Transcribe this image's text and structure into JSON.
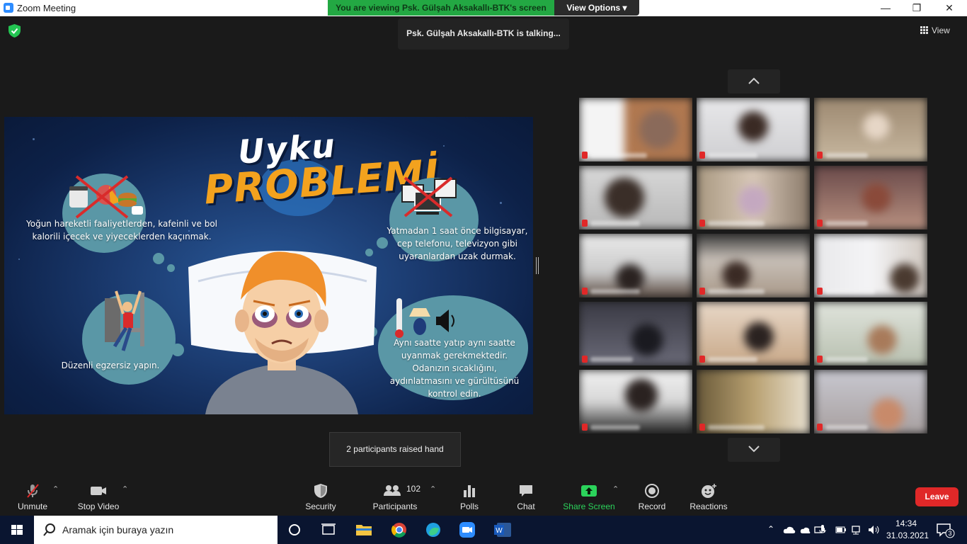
{
  "window": {
    "title": "Zoom Meeting",
    "minimize": "—",
    "maximize": "❐",
    "close": "✕"
  },
  "share_banner": {
    "viewing": "You are viewing Psk. Gülşah Aksakallı-BTK's screen",
    "view_options": "View Options ▾"
  },
  "talking": "Psk. Gülşah Aksakallı-BTK is talking...",
  "view_button": "View",
  "slide": {
    "title_line1": "Uyku",
    "title_line2": "PROBLEMİ",
    "tip1": "Yoğun hareketli faaliyetlerden, kafeinli ve bol kalorili içecek ve yiyeceklerden kaçınmak.",
    "tip2": "Yatmadan 1 saat önce bilgisayar, cep telefonu, televizyon gibi uyaranlardan uzak durmak.",
    "tip3": "Düzenli egzersiz yapın.",
    "tip4": "Aynı saatte yatıp aynı saatte uyanmak gerekmektedir. Odanızın sıcaklığını, aydınlatmasını ve gürültüsünü kontrol edin."
  },
  "raised_hand_tooltip": "2 participants raised hand",
  "toolbar": {
    "unmute": "Unmute",
    "stop_video": "Stop Video",
    "security": "Security",
    "participants": "Participants",
    "participants_count": "102",
    "polls": "Polls",
    "chat": "Chat",
    "share_screen": "Share Screen",
    "record": "Record",
    "reactions": "Reactions",
    "leave": "Leave"
  },
  "taskbar": {
    "search_placeholder": "Aramak için buraya yazın",
    "time": "14:34",
    "date": "31.03.2021",
    "notifications": "3"
  },
  "colors": {
    "share_banner": "#23a843",
    "leave": "#e02828",
    "share_screen": "#2bd35b",
    "title_accent": "#f3a21e"
  }
}
